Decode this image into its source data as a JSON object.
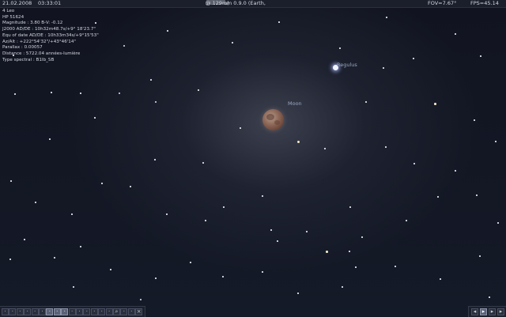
{
  "topbar": {
    "date": "21.02.2008",
    "time": "03:33:01",
    "title_prefix": "Stellarium 0.9.0 (Earth,",
    "title_suffix": "@ 129m)",
    "fov": "FOV=7.67°",
    "fps": "FPS=45.14"
  },
  "object_info": {
    "lines": [
      "4  Leo",
      "HP 51624",
      "Magnitude : 3.80 B-V: -0.12",
      "J2000 AD/DE :   10h32m48.7s/+9°  18'23.7\"",
      "Equ of date AD/DE : 10h33m34s/+9°15'53\"",
      "Az/Alt : +222°54'32\"/+43°46'14\"",
      "Parallax : 0.00057",
      "Distance : 5722.04 années-lumière",
      "Type spectral : B1Ib_SB"
    ]
  },
  "sky_labels": {
    "regulus": "Regulus",
    "moon": "Moon"
  },
  "toolbar": {
    "button_icons": [
      "constellation-lines-icon",
      "constellation-names-icon",
      "constellation-art-icon",
      "equatorial-grid-icon",
      "azimuthal-grid-icon",
      "ground-icon",
      "cardinal-points-icon",
      "atmosphere-icon",
      "nebulae-icon",
      "planet-hints-icon",
      "equatorial-mount-icon",
      "center-object-icon",
      "night-mode-icon",
      "full-screen-icon",
      "telescope-icon",
      "search-icon",
      "configuration-icon",
      "help-icon",
      "quit-icon"
    ],
    "active_indices": [
      6,
      7,
      8
    ]
  },
  "time_controls": {
    "button_icons": [
      "rewind-icon",
      "play-icon",
      "real-time-icon",
      "fast-forward-icon"
    ]
  },
  "colors": {
    "sky": "#131622",
    "topbar_bg": "#1b1f2c",
    "moon": "#8f6a5a",
    "label": "#9aa7c0"
  }
}
